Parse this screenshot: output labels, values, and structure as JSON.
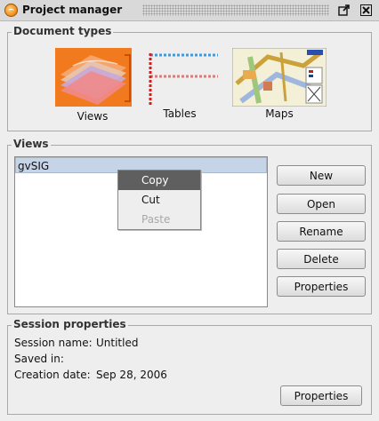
{
  "window": {
    "title": "Project manager"
  },
  "document_types": {
    "legend": "Document types",
    "items": [
      {
        "label": "Views"
      },
      {
        "label": "Tables"
      },
      {
        "label": "Maps"
      }
    ]
  },
  "views": {
    "legend": "Views",
    "list": [
      "gvSIG"
    ],
    "buttons": {
      "new": "New",
      "open": "Open",
      "rename": "Rename",
      "delete": "Delete",
      "properties": "Properties"
    },
    "context_menu": {
      "items": [
        {
          "label": "Copy",
          "state": "highlighted"
        },
        {
          "label": "Cut",
          "state": "enabled"
        },
        {
          "label": "Paste",
          "state": "disabled"
        }
      ]
    }
  },
  "session": {
    "legend": "Session properties",
    "name_label": "Session name:",
    "name_value": "Untitled",
    "saved_label": "Saved in:",
    "saved_value": "",
    "created_label": "Creation date:",
    "created_value": "Sep 28, 2006",
    "properties_button": "Properties"
  },
  "colors": {
    "selection": "#c6d4e8",
    "menu_highlight": "#5f5f5f",
    "views_icon": "#f27a1e"
  }
}
